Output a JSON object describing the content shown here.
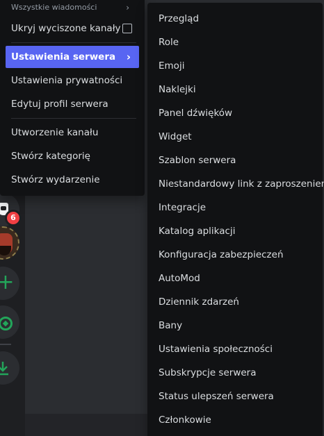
{
  "menu": {
    "header": "Wszystkie wiadomości",
    "mute_label": "Ukryj wyciszone kanały",
    "server_settings_label": "Ustawienia serwera",
    "privacy_label": "Ustawienia prywatności",
    "edit_profile_label": "Edytuj profil serwera",
    "create_channel_label": "Utworzenie kanału",
    "create_category_label": "Stwórz kategorię",
    "create_event_label": "Stwórz wydarzenie"
  },
  "submenu": {
    "items": [
      "Przegląd",
      "Role",
      "Emoji",
      "Naklejki",
      "Panel dźwięków",
      "Widget",
      "Szablon serwera",
      "Niestandardowy link z zaproszeniem",
      "Integracje",
      "Katalog aplikacji",
      "Konfiguracja zabezpieczeń",
      "AutoMod",
      "Dziennik zdarzeń",
      "Bany",
      "Ustawienia społeczności",
      "Subskrypcje serwera",
      "Status ulepszeń serwera",
      "Członkowie"
    ]
  },
  "rail": {
    "badge_count": "6",
    "add_glyph": "+"
  },
  "icons": {
    "chevron": "chevron-right-icon",
    "checkbox": "checkbox-icon",
    "add": "plus-icon",
    "explore": "compass-icon",
    "download": "download-icon"
  },
  "colors": {
    "accent": "#5865f2",
    "menu_bg": "#111214",
    "text": "#dbdee1",
    "green": "#23a55a",
    "badge": "#f23f43"
  }
}
